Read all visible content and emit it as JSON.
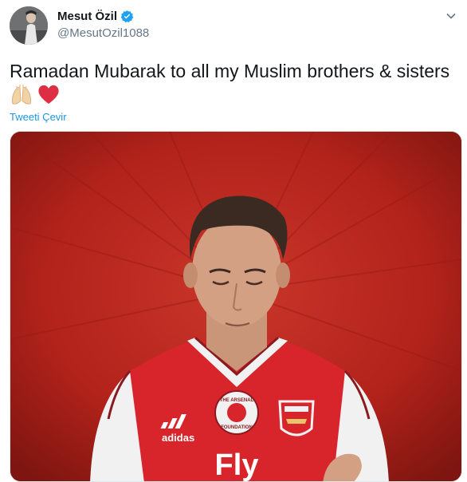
{
  "author": {
    "display_name": "Mesut Özil",
    "handle": "@MesutOzil1088",
    "verified": true
  },
  "tweet": {
    "text": "Ramadan Mubarak to all my Muslim brothers & sisters",
    "emojis": [
      "folded-hands-emoji",
      "red-heart-emoji"
    ],
    "translate_label": "Tweeti Çevir"
  },
  "media": {
    "shirt_sponsor": "Fly",
    "crest_text": "Arsenal",
    "foundation_badge_text": "THE ARSENAL FOUNDATION",
    "kit_brand": "adidas"
  },
  "colors": {
    "accent": "#1b95e0",
    "verified": "#1da1f2",
    "text": "#14171a",
    "secondary": "#657786",
    "background_red": "#b3201a",
    "heart": "#e0245e"
  }
}
